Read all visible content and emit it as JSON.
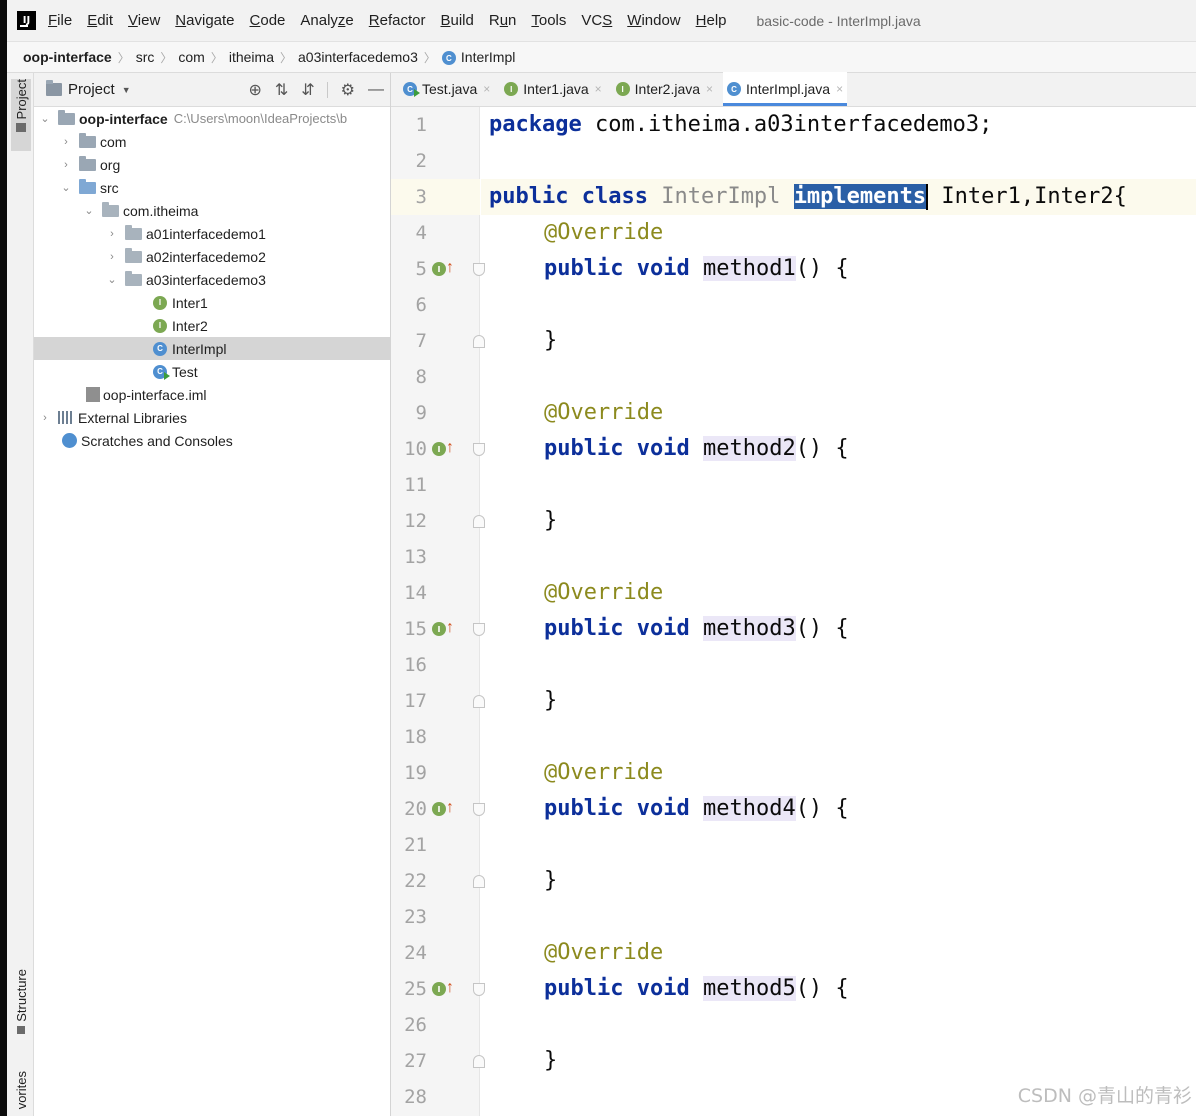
{
  "menu": {
    "logo": "IJ",
    "items": [
      {
        "u": "F",
        "rest": "ile"
      },
      {
        "u": "E",
        "rest": "dit"
      },
      {
        "u": "V",
        "rest": "iew"
      },
      {
        "u": "N",
        "rest": "avigate"
      },
      {
        "u": "C",
        "rest": "ode"
      },
      {
        "pre": "Analy",
        "u": "z",
        "rest": "e"
      },
      {
        "u": "R",
        "rest": "efactor"
      },
      {
        "u": "B",
        "rest": "uild"
      },
      {
        "pre": "R",
        "u": "u",
        "rest": "n"
      },
      {
        "u": "T",
        "rest": "ools"
      },
      {
        "pre": "VC",
        "u": "S",
        "rest": ""
      },
      {
        "u": "W",
        "rest": "indow"
      },
      {
        "u": "H",
        "rest": "elp"
      }
    ],
    "window_title": "basic-code - InterImpl.java"
  },
  "breadcrumb": {
    "items": [
      "oop-interface",
      "src",
      "com",
      "itheima",
      "a03interfacedemo3",
      "InterImpl"
    ],
    "class_badge": "C"
  },
  "tool_strip": {
    "project": "Project",
    "structure": "Structure",
    "favorites": "vorites"
  },
  "project_panel": {
    "title": "Project",
    "caret": "▼",
    "tools": [
      "⊕",
      "⇅",
      "⇵",
      "⚙",
      "—"
    ],
    "tree": [
      {
        "label": "oop-interface",
        "path": "C:\\Users\\moon\\IdeaProjects\\b",
        "arrow": "⌄"
      },
      {
        "label": "com",
        "arrow": "›"
      },
      {
        "label": "org",
        "arrow": "›"
      },
      {
        "label": "src",
        "arrow": "⌄"
      },
      {
        "label": "com.itheima",
        "arrow": "⌄"
      },
      {
        "label": "a01interfacedemo1",
        "arrow": "›"
      },
      {
        "label": "a02interfacedemo2",
        "arrow": "›"
      },
      {
        "label": "a03interfacedemo3",
        "arrow": "⌄"
      },
      {
        "label": "Inter1",
        "badge": "I"
      },
      {
        "label": "Inter2",
        "badge": "I"
      },
      {
        "label": "InterImpl",
        "badge": "C"
      },
      {
        "label": "Test",
        "badge": "C"
      },
      {
        "label": "oop-interface.iml"
      },
      {
        "label": "External Libraries",
        "arrow": "›"
      },
      {
        "label": "Scratches and Consoles"
      }
    ]
  },
  "editor": {
    "tabs": [
      {
        "label": "Test.java",
        "badge": "C",
        "close": "×"
      },
      {
        "label": "Inter1.java",
        "badge": "I",
        "close": "×"
      },
      {
        "label": "Inter2.java",
        "badge": "I",
        "close": "×"
      },
      {
        "label": "InterImpl.java",
        "badge": "C",
        "close": "×"
      }
    ],
    "code": {
      "l1_kw": "package",
      "l1_rest": " com.itheima.a03interfacedemo3;",
      "l3_kw1": "public",
      "l3_kw2": "class",
      "l3_name": "InterImpl",
      "l3_sel": "implements",
      "l3_a": "Inte",
      "l3_b": "r1,Inter2{",
      "override": "@Override",
      "kw_public": "public",
      "kw_void": "void",
      "methods": [
        "method1",
        "method2",
        "method3",
        "method4",
        "method5"
      ],
      "parens": "() {",
      "close_brace": "}"
    },
    "impl_badge": "I",
    "up_arrow": "↑"
  },
  "watermark": "CSDN @青山的青衫"
}
